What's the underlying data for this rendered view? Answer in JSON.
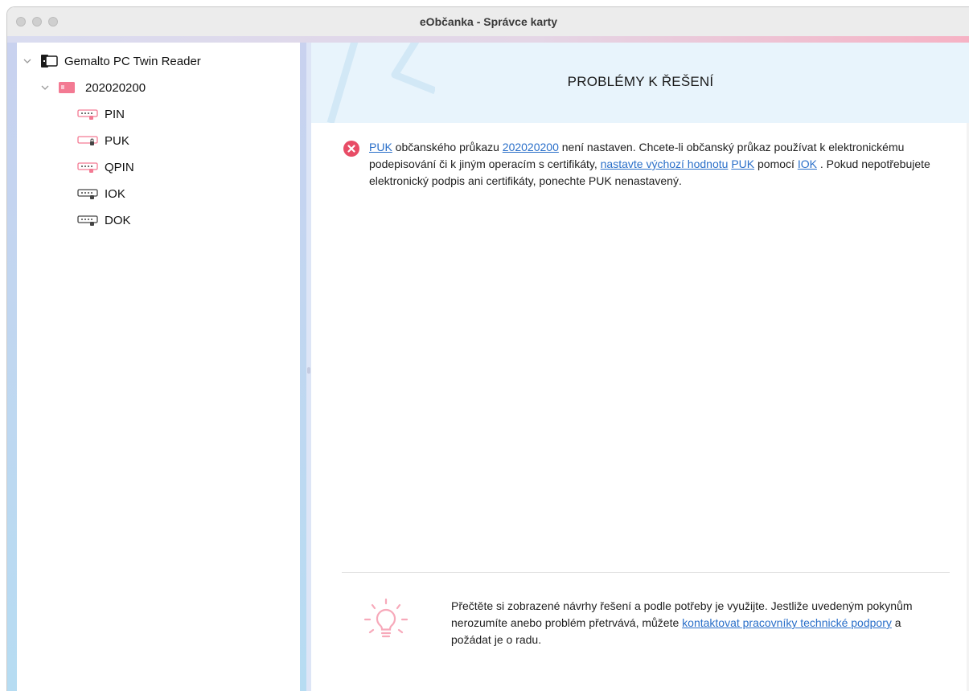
{
  "window": {
    "title": "eObčanka - Správce karty"
  },
  "tree": {
    "reader": {
      "label": "Gemalto PC Twin Reader",
      "icon": "card-reader-icon"
    },
    "card": {
      "label": "202020200",
      "icon": "id-card-icon"
    },
    "items": [
      {
        "label": "PIN",
        "icon": "pin-keypad-icon"
      },
      {
        "label": "PUK",
        "icon": "puk-lock-icon"
      },
      {
        "label": "QPIN",
        "icon": "pin-keypad-icon"
      },
      {
        "label": "IOK",
        "icon": "key-icon"
      },
      {
        "label": "DOK",
        "icon": "key-icon"
      }
    ]
  },
  "main": {
    "header_title": "PROBLÉMY K ŘEŠENÍ",
    "problem": {
      "link_puk": "PUK",
      "t1": " občanského průkazu ",
      "link_card": "202020200",
      "t2": " není nastaven. Chcete-li občanský průkaz používat k elektronickému podepisování či k jiným operacím s certifikáty, ",
      "link_set_default": "nastavte výchozí hodnotu",
      "t3": " ",
      "link_puk2": "PUK",
      "t4": " pomocí ",
      "link_iok": "IOK",
      "t5": " . Pokud nepotřebujete elektronický podpis ani certifikáty, ponechte PUK nenastavený."
    },
    "tip": {
      "t1": "Přečtěte si zobrazené návrhy řešení a podle potřeby je využijte. Jestliže uvedeným pokynům nerozumíte anebo problém přetrvává, můžete ",
      "link_support": "kontaktovat pracovníky technické podpory",
      "t2": " a požádat je o radu."
    }
  },
  "colors": {
    "accent_pink": "#e84c66",
    "link": "#2a6fc9",
    "header_bg": "#e8f4fc"
  }
}
